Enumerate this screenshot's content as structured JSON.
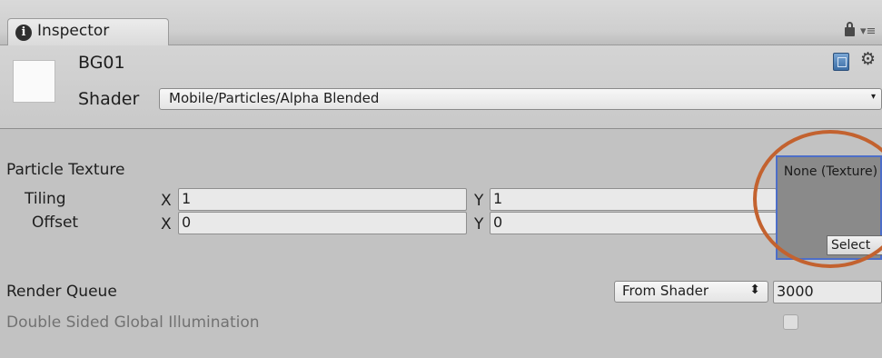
{
  "tab": {
    "label": "Inspector",
    "info_glyph": "i"
  },
  "header": {
    "material_name": "BG01",
    "shader_label": "Shader",
    "shader_value": "Mobile/Particles/Alpha Blended",
    "dropdown_arrow": "▾"
  },
  "icons": {
    "lock": "lock-icon",
    "menu": "tab-menu-icon",
    "help": "help-book-icon",
    "settings": "gear-icon",
    "menu_glyph": "▾≡",
    "gear_glyph": "⚙"
  },
  "properties": {
    "particle_texture_label": "Particle Texture",
    "tiling": {
      "label": "Tiling",
      "x_label": "X",
      "x_value": "1",
      "y_label": "Y",
      "y_value": "1"
    },
    "offset": {
      "label": "Offset",
      "x_label": "X",
      "x_value": "0",
      "y_label": "Y",
      "y_value": "0"
    },
    "texture_slot": {
      "text": "None (Texture)",
      "select_label": "Select"
    },
    "render_queue": {
      "label": "Render Queue",
      "mode": "From Shader",
      "mode_arrow": "⬍",
      "value": "3000"
    },
    "double_sided_gi": {
      "label": "Double Sided Global Illumination",
      "checked": false
    }
  },
  "colors": {
    "panel_bg": "#c2c2c2",
    "highlight": "#c3622f",
    "selection": "#4d6ec8"
  }
}
